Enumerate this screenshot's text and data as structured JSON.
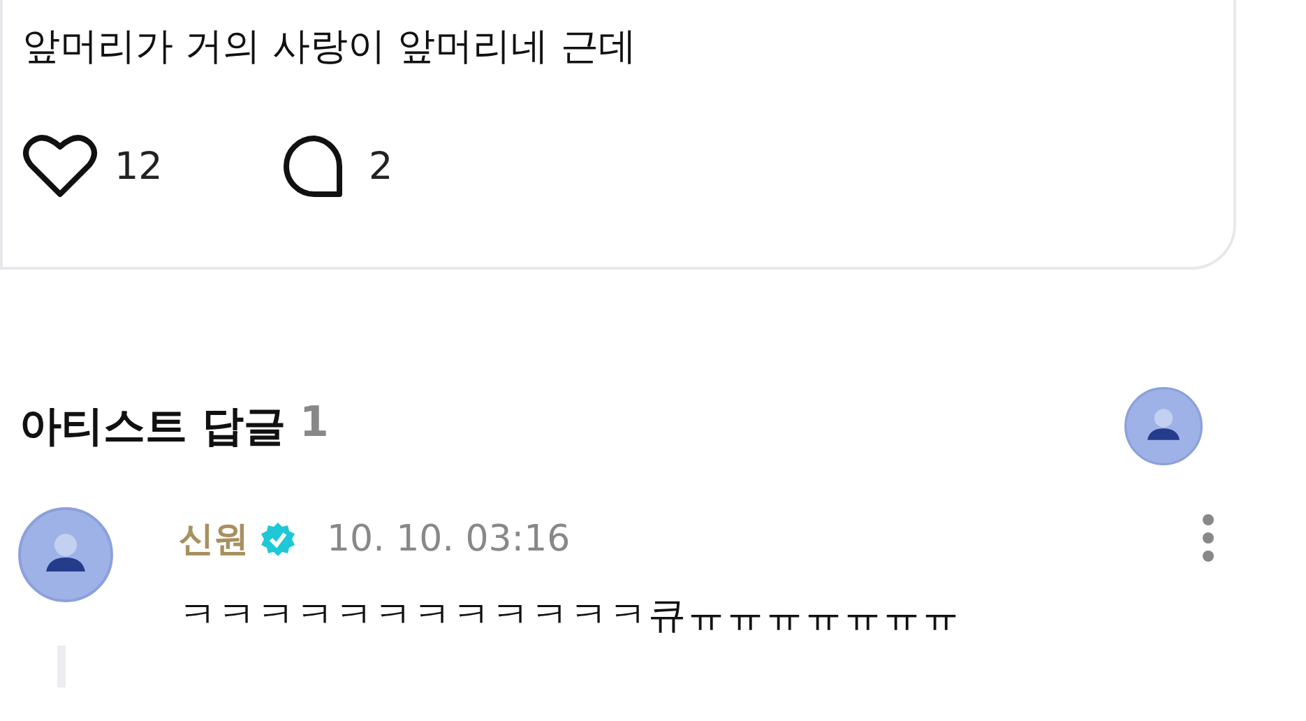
{
  "post": {
    "text": "앞머리가 거의 사랑이 앞머리네 근데",
    "likes": "12",
    "comments": "2"
  },
  "artist_replies": {
    "title": "아티스트 답글",
    "count": "1"
  },
  "comments": [
    {
      "author": "신원",
      "verified": true,
      "time": "10. 10. 03:16",
      "text": "ㅋㅋㅋㅋㅋㅋㅋㅋㅋㅋㅋㅋ큐ㅠㅠㅠㅠㅠㅠㅠ"
    }
  ]
}
